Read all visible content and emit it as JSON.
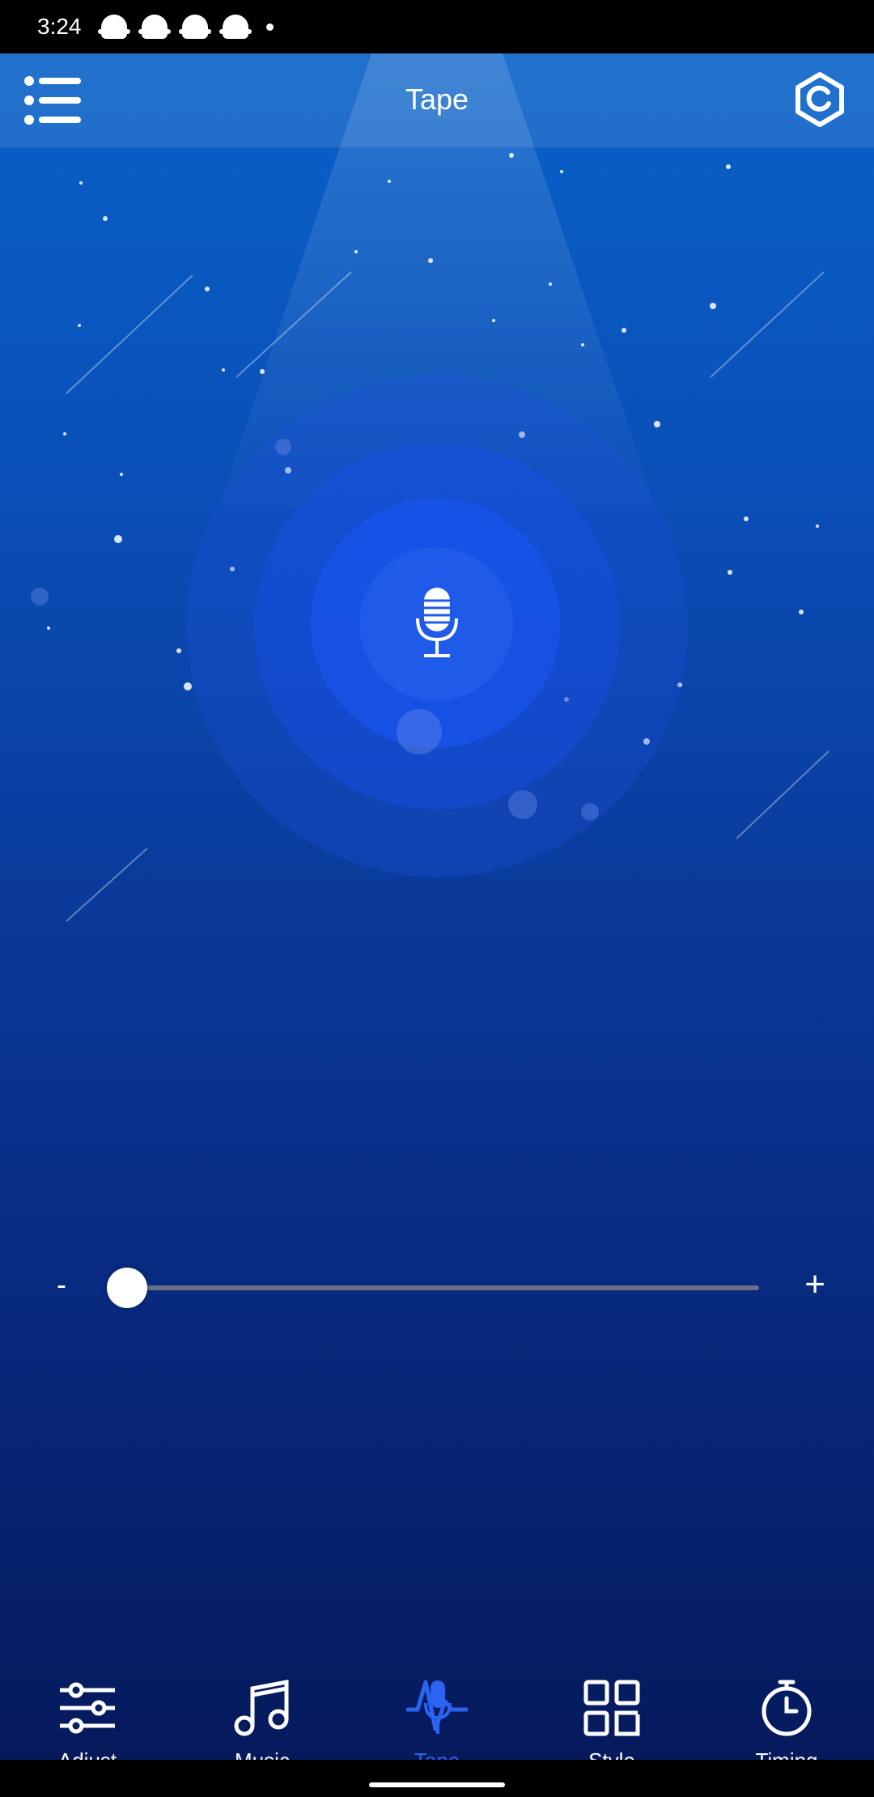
{
  "status_bar": {
    "time": "3:24",
    "notification_icons": [
      "snapchat-icon",
      "snapchat-icon",
      "snapchat-icon",
      "snapchat-icon"
    ]
  },
  "header": {
    "title": "Tape",
    "menu_icon": "list-menu-icon",
    "settings_icon": "gear-icon"
  },
  "record": {
    "icon": "microphone-icon"
  },
  "slider": {
    "min_label": "-",
    "max_label": "+",
    "value_fraction": 0.0
  },
  "nav": {
    "items": [
      {
        "label": "Adjust",
        "icon": "sliders-icon",
        "active": false
      },
      {
        "label": "Music",
        "icon": "music-note-icon",
        "active": false
      },
      {
        "label": "Tape",
        "icon": "mic-wave-icon",
        "active": true
      },
      {
        "label": "Style",
        "icon": "grid-icon",
        "active": false
      },
      {
        "label": "Timing",
        "icon": "timer-icon",
        "active": false
      }
    ]
  },
  "colors": {
    "active": "#2b63f2",
    "inactive": "#ffffff"
  }
}
